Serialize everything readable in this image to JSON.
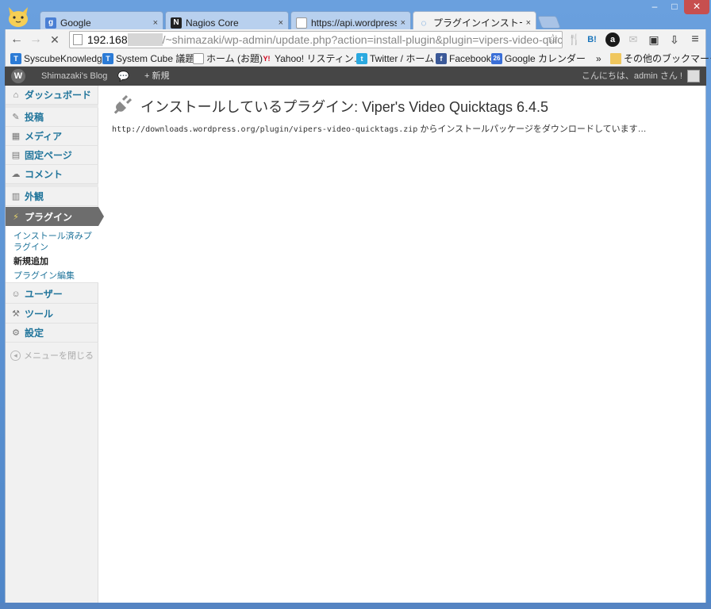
{
  "browser": {
    "tabs": [
      {
        "label": "Google",
        "icon": "google-icon",
        "icon_glyph": "g",
        "icon_color": "#4a7fd4"
      },
      {
        "label": "Nagios Core",
        "icon": "nagios-icon",
        "icon_glyph": "N",
        "icon_color": "#222222"
      },
      {
        "label": "https://api.wordpress.o",
        "icon": "page-icon",
        "icon_glyph": "",
        "icon_color": "#ffffff"
      },
      {
        "label": "プラグインインストール",
        "icon": "loading-icon",
        "icon_glyph": "◌",
        "icon_color": "#2f7fd6"
      }
    ],
    "tab_close_glyph": "×",
    "window_buttons": {
      "minimize": "–",
      "maximize": "□",
      "close": "✕"
    },
    "nav": {
      "back": "←",
      "forward": "→",
      "stop": "✕"
    },
    "address": {
      "host": "192.168",
      "path": "/~shimazaki/wp-admin/update.php?action=install-plugin&plugin=vipers-video-quic"
    },
    "star": "☆",
    "extensions": [
      {
        "name": "fork-icon",
        "glyph": "🍴",
        "color": "#e89a1c"
      },
      {
        "name": "hatena-bookmark-icon",
        "glyph": "B!",
        "color": "#1b75bb"
      },
      {
        "name": "a-icon",
        "glyph": "a",
        "color": "#1a1a1a"
      },
      {
        "name": "mail-icon",
        "glyph": "✉",
        "color": "#bbbbbb"
      },
      {
        "name": "puzzle-icon",
        "glyph": "▣",
        "color": "#333333"
      },
      {
        "name": "download-icon",
        "glyph": "⇩",
        "color": "#555555"
      },
      {
        "name": "menu-icon",
        "glyph": "≡",
        "color": "#444444"
      }
    ],
    "bookmarks": [
      {
        "label": "SyscubeKnowledge",
        "icon": "syscube-icon",
        "glyph": "T",
        "color": "#2b7bd6"
      },
      {
        "label": "System Cube 議題",
        "icon": "syscube-icon",
        "glyph": "T",
        "color": "#2b7bd6"
      },
      {
        "label": "ホーム (お題)",
        "icon": "page-icon",
        "glyph": "",
        "color": "#ffffff"
      },
      {
        "label": "Yahoo! リスティン…",
        "icon": "yahoo-icon",
        "glyph": "Y!",
        "color": "#d0021b"
      },
      {
        "label": "Twitter / ホーム",
        "icon": "twitter-icon",
        "glyph": "t",
        "color": "#2aa9e0"
      },
      {
        "label": "Facebook",
        "icon": "facebook-icon",
        "glyph": "f",
        "color": "#3b5998"
      },
      {
        "label": "Google カレンダー",
        "icon": "calendar-icon",
        "glyph": "26",
        "color": "#3a6fd8"
      }
    ],
    "bookmarks_overflow": "»",
    "other_bookmarks": "その他のブックマーク"
  },
  "adminbar": {
    "site_name": "Shimazaki's Blog",
    "comments_glyph": "💬",
    "new_label": "+ 新規",
    "greeting": "こんにちは、admin さん !"
  },
  "sidebar": {
    "items": [
      {
        "label": "ダッシュボード",
        "icon": "dashboard-icon",
        "glyph": "⌂"
      },
      {
        "label": "投稿",
        "icon": "pin-icon",
        "glyph": "✎"
      },
      {
        "label": "メディア",
        "icon": "media-icon",
        "glyph": "▦"
      },
      {
        "label": "固定ページ",
        "icon": "pages-icon",
        "glyph": "▤"
      },
      {
        "label": "コメント",
        "icon": "comment-icon",
        "glyph": "☁"
      },
      {
        "label": "外観",
        "icon": "appearance-icon",
        "glyph": "▥"
      },
      {
        "label": "プラグイン",
        "icon": "plugin-icon",
        "glyph": "⚡"
      },
      {
        "label": "ユーザー",
        "icon": "users-icon",
        "glyph": "☺"
      },
      {
        "label": "ツール",
        "icon": "tools-icon",
        "glyph": "⚒"
      },
      {
        "label": "設定",
        "icon": "settings-icon",
        "glyph": "⚙"
      }
    ],
    "submenu": [
      "インストール済みプラグイン",
      "新規追加",
      "プラグイン編集"
    ],
    "collapse_label": "メニューを閉じる",
    "collapse_glyph": "◂"
  },
  "main": {
    "title": "インストールしているプラグイン: Viper's Video Quicktags 6.4.5",
    "log_url": "http://downloads.wordpress.org/plugin/vipers-video-quicktags.zip",
    "log_text": " からインストールパッケージをダウンロードしています…"
  }
}
